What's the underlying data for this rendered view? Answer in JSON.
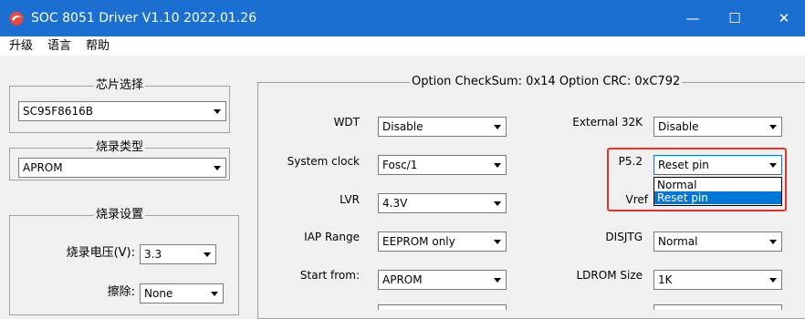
{
  "window": {
    "title": "SOC 8051 Driver V1.10 2022.01.26",
    "minimize": "—",
    "maximize": "☐",
    "close": "✕",
    "titlebar_color": "#1b6fd1"
  },
  "menu": [
    "升级",
    "语言",
    "帮助"
  ],
  "chip_select": {
    "legend": "芯片选择",
    "value": "SC95F8616B"
  },
  "burn_type": {
    "legend": "烧录类型",
    "value": "APROM"
  },
  "burn_settings": {
    "legend": "烧录设置",
    "voltage_label": "烧录电压(V):",
    "voltage_value": "3.3",
    "erase_label": "擦除:",
    "erase_value": "None"
  },
  "option_group": {
    "legend": "Option CheckSum:  0x14  Option CRC:  0xC792",
    "fields": [
      {
        "label": "WDT",
        "value": "Disable"
      },
      {
        "label": "System clock",
        "value": "Fosc/1"
      },
      {
        "label": "LVR",
        "value": "4.3V"
      },
      {
        "label": "IAP Range",
        "value": "EEPROM only"
      },
      {
        "label": "Start from:",
        "value": "APROM"
      },
      {
        "label": "External 32K",
        "value": "Disable"
      },
      {
        "label": "P5.2",
        "value": "Reset pin"
      },
      {
        "label": "Vref",
        "value": ""
      },
      {
        "label": "DISJTG",
        "value": "Normal"
      },
      {
        "label": "LDROM Size",
        "value": "1K"
      }
    ]
  },
  "dropdown": {
    "options": [
      "Normal",
      "Reset pin"
    ],
    "selected": "Reset pin"
  },
  "highlight_color": "#e6332a"
}
